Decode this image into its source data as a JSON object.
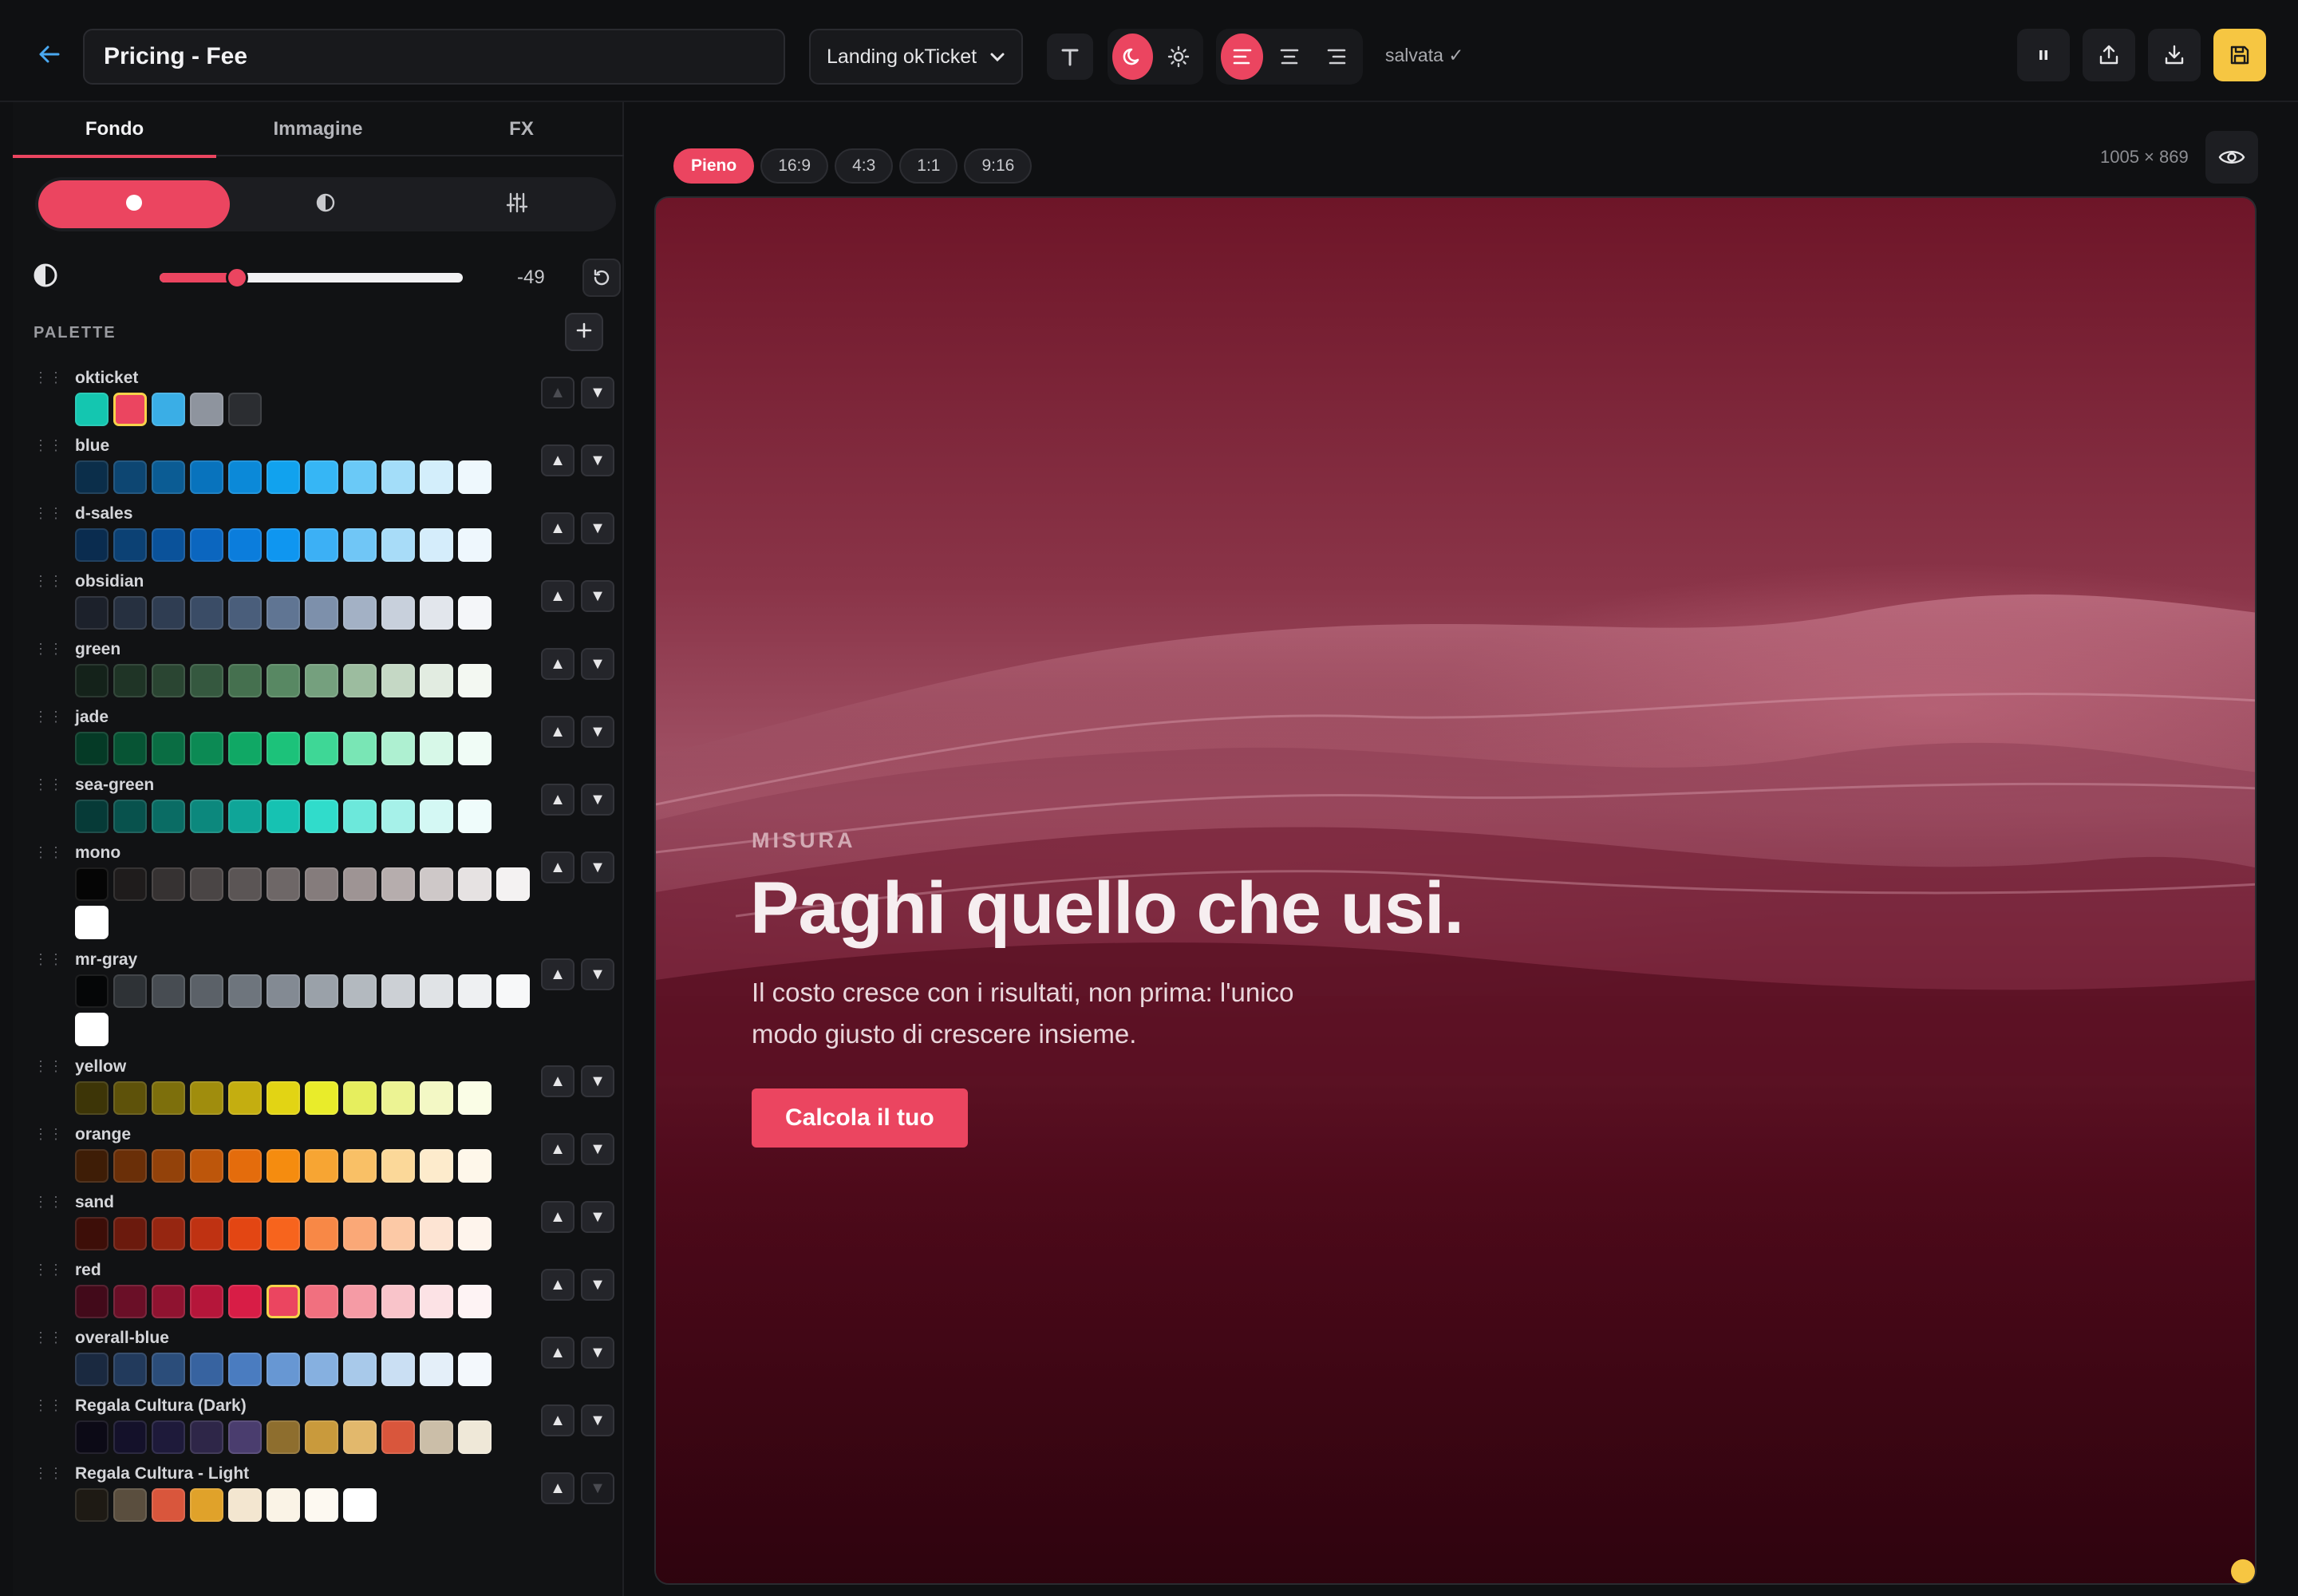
{
  "header": {
    "title": "Pricing - Fee",
    "project_select": "Landing okTicket",
    "status": "salvata ✓"
  },
  "tabs": [
    "Fondo",
    "Immagine",
    "FX"
  ],
  "slider": {
    "value_label": "-49",
    "value": -49
  },
  "palette_heading": "PALETTE",
  "palettes": [
    {
      "name": "okticket",
      "colors": [
        "#14c6b0",
        "#eb4560",
        "#3aaee6",
        "#8e949e",
        "#2b2d31"
      ],
      "selected": 1,
      "up_enabled": false
    },
    {
      "name": "blue",
      "colors": [
        "#0b2e4a",
        "#0d4672",
        "#0b5c94",
        "#0873bd",
        "#0b89d8",
        "#11a2ee",
        "#36b6f5",
        "#6ac9f7",
        "#a3ddf9",
        "#d3eefb",
        "#eef8fd"
      ]
    },
    {
      "name": "d-sales",
      "colors": [
        "#0a2c4f",
        "#0c4174",
        "#0a529a",
        "#0b66bf",
        "#0b7ddc",
        "#0f96f0",
        "#3cb0f5",
        "#70c6f6",
        "#a8dcf8",
        "#d5edfb",
        "#eef7fd"
      ]
    },
    {
      "name": "obsidian",
      "colors": [
        "#1c212b",
        "#263040",
        "#2f3d52",
        "#3a4c66",
        "#4a5e7b",
        "#607593",
        "#7d90ab",
        "#a3b1c5",
        "#c8d0dc",
        "#e2e6ec",
        "#f4f6f9"
      ]
    },
    {
      "name": "green",
      "colors": [
        "#14221a",
        "#1f3426",
        "#2a4532",
        "#35583f",
        "#45704f",
        "#588863",
        "#75a07e",
        "#9cbc9f",
        "#c5d8c5",
        "#e2ece1",
        "#f3f8f2"
      ]
    },
    {
      "name": "jade",
      "colors": [
        "#053a26",
        "#075434",
        "#0a6d43",
        "#0c8a54",
        "#10a865",
        "#1cc27a",
        "#3ed796",
        "#79e6b5",
        "#aef0d1",
        "#d7f8e8",
        "#f0fcf6"
      ]
    },
    {
      "name": "sea-green",
      "colors": [
        "#063a37",
        "#08524d",
        "#0a6c64",
        "#0c887d",
        "#0fa598",
        "#16c2b2",
        "#30dccb",
        "#6ce8db",
        "#a6f1e9",
        "#d4f8f4",
        "#effcfb"
      ]
    },
    {
      "name": "mono",
      "colors": [
        "#050505",
        "#1f1c1c",
        "#363232",
        "#4a4545",
        "#5b5555",
        "#6e6767",
        "#857c7c",
        "#9e9494",
        "#b6adad",
        "#cec8c8",
        "#e6e2e2",
        "#f4f2f2",
        "#ffffff"
      ]
    },
    {
      "name": "mr-gray",
      "colors": [
        "#050607",
        "#2e3236",
        "#474c52",
        "#5b6168",
        "#6e757d",
        "#838a93",
        "#9aa1a9",
        "#b3b9bf",
        "#ccd0d5",
        "#e0e3e6",
        "#eef0f2",
        "#f7f8f9",
        "#ffffff"
      ]
    },
    {
      "name": "yellow",
      "colors": [
        "#3d3507",
        "#5e520a",
        "#7d6f0c",
        "#a08d0d",
        "#c4ae10",
        "#e2d414",
        "#e9ec2a",
        "#e6ee5e",
        "#ecf393",
        "#f3f8c5",
        "#fafde6"
      ]
    },
    {
      "name": "orange",
      "colors": [
        "#3e1d06",
        "#6a2f08",
        "#93420a",
        "#bd560b",
        "#e46c0c",
        "#f58c0f",
        "#f7a533",
        "#f9c066",
        "#fbd899",
        "#fdebcc",
        "#fef7ea"
      ]
    },
    {
      "name": "sand",
      "colors": [
        "#3d0e08",
        "#6b1a0d",
        "#962611",
        "#bf3212",
        "#e34613",
        "#f7641d",
        "#f88846",
        "#faa877",
        "#fcc9a6",
        "#fde4d3",
        "#fef4ec"
      ]
    },
    {
      "name": "red",
      "colors": [
        "#420a1a",
        "#6a0f27",
        "#8f1330",
        "#b5163a",
        "#d81d46",
        "#eb4560",
        "#f1707f",
        "#f59ba5",
        "#f9c4ca",
        "#fce2e5",
        "#fef3f4"
      ],
      "selected": 5
    },
    {
      "name": "overall-blue",
      "colors": [
        "#1a2940",
        "#223a5c",
        "#2b4d7a",
        "#3763a0",
        "#4a7cc0",
        "#6797d3",
        "#86b0e0",
        "#a8c9ea",
        "#cadff3",
        "#e4eff9",
        "#f3f8fc"
      ]
    },
    {
      "name": "Regala Cultura (Dark)",
      "colors": [
        "#0c0a16",
        "#14112a",
        "#1e1a3a",
        "#2e2648",
        "#4a3d6e",
        "#8e6e2e",
        "#c99a3c",
        "#e2b86c",
        "#d9563c",
        "#cbbea8",
        "#efe8d8"
      ]
    },
    {
      "name": "Regala Cultura - Light",
      "colors": [
        "#1e1a14",
        "#5a4e3e",
        "#d9563c",
        "#e0a22a",
        "#f3e6d0",
        "#faf3e6",
        "#fdf9f1",
        "#ffffff"
      ],
      "down_enabled": false
    }
  ],
  "ratios": [
    "Pieno",
    "16:9",
    "4:3",
    "1:1",
    "9:16"
  ],
  "dimensions": "1005 × 869",
  "preview": {
    "kicker": "MISURA",
    "headline": "Paghi quello che usi.",
    "subtext": "Il costo cresce con i risultati, non prima: l'unico modo giusto di crescere insieme.",
    "cta": "Calcola il tuo"
  },
  "colors": {
    "accent": "#eb4560",
    "save": "#f6c642",
    "link": "#4aa8f0"
  }
}
